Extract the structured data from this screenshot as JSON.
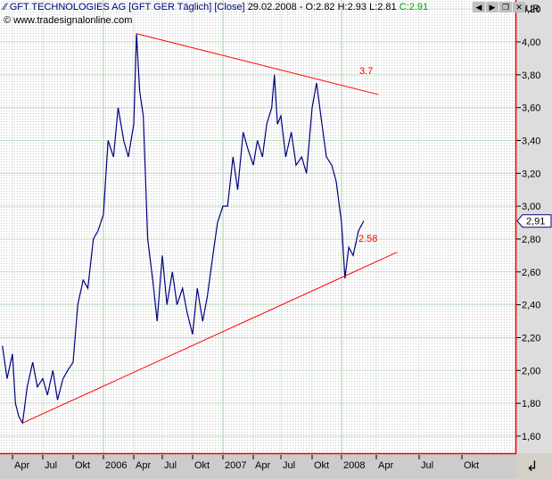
{
  "header": {
    "title": "GFT TECHNOLOGIES AG [GFT GER  Täglich] [Close]",
    "date": "29.02.2008",
    "ohlc": "- O:2.82 H:2.93 L:2.81",
    "close": "C:2.91",
    "copyright": "© www.tradesignalonline.com",
    "icons": [
      "arrow-left-icon",
      "arrow-right-icon",
      "restore-icon",
      "close-icon"
    ]
  },
  "chart_data": {
    "type": "line",
    "currency": "EUR",
    "ylim": [
      1.55,
      4.3
    ],
    "yticks": [
      "4,20",
      "4,00",
      "3,80",
      "3,60",
      "3,40",
      "3,20",
      "3,00",
      "2,80",
      "2,60",
      "2,40",
      "2,20",
      "2,00",
      "1,80",
      "1,60"
    ],
    "xticks": [
      {
        "label": "Apr",
        "date": "2005-04-01"
      },
      {
        "label": "Jul",
        "date": "2005-07-01"
      },
      {
        "label": "Okt",
        "date": "2005-10-01"
      },
      {
        "label": "2006",
        "date": "2006-01-01"
      },
      {
        "label": "Apr",
        "date": "2006-04-01"
      },
      {
        "label": "Jul",
        "date": "2006-07-01"
      },
      {
        "label": "Okt",
        "date": "2006-10-01"
      },
      {
        "label": "2007",
        "date": "2007-01-01"
      },
      {
        "label": "Apr",
        "date": "2007-04-01"
      },
      {
        "label": "Jul",
        "date": "2007-07-01"
      },
      {
        "label": "Okt",
        "date": "2007-10-01"
      },
      {
        "label": "2008",
        "date": "2008-01-01"
      },
      {
        "label": "Apr",
        "date": "2008-04-01"
      },
      {
        "label": "Jul",
        "date": "2008-07-01"
      },
      {
        "label": "Okt",
        "date": "2008-10-01"
      }
    ],
    "last_value_label": "2,91",
    "series_color": "#000080",
    "trendline_color": "#ff0000",
    "series": [
      [
        "2005-03-01",
        2.15
      ],
      [
        "2005-03-15",
        1.95
      ],
      [
        "2005-04-01",
        2.1
      ],
      [
        "2005-04-10",
        1.8
      ],
      [
        "2005-04-20",
        1.72
      ],
      [
        "2005-05-01",
        1.68
      ],
      [
        "2005-05-15",
        1.9
      ],
      [
        "2005-06-01",
        2.05
      ],
      [
        "2005-06-15",
        1.9
      ],
      [
        "2005-07-01",
        1.95
      ],
      [
        "2005-07-15",
        1.85
      ],
      [
        "2005-08-01",
        2.0
      ],
      [
        "2005-08-15",
        1.82
      ],
      [
        "2005-09-01",
        1.95
      ],
      [
        "2005-09-15",
        2.0
      ],
      [
        "2005-10-01",
        2.05
      ],
      [
        "2005-10-15",
        2.4
      ],
      [
        "2005-11-01",
        2.55
      ],
      [
        "2005-11-15",
        2.5
      ],
      [
        "2005-12-01",
        2.8
      ],
      [
        "2005-12-15",
        2.85
      ],
      [
        "2006-01-01",
        2.95
      ],
      [
        "2006-01-15",
        3.4
      ],
      [
        "2006-02-01",
        3.3
      ],
      [
        "2006-02-15",
        3.6
      ],
      [
        "2006-03-01",
        3.4
      ],
      [
        "2006-03-15",
        3.3
      ],
      [
        "2006-04-01",
        3.5
      ],
      [
        "2006-04-10",
        4.05
      ],
      [
        "2006-04-20",
        3.7
      ],
      [
        "2006-05-01",
        3.55
      ],
      [
        "2006-05-15",
        2.8
      ],
      [
        "2006-06-01",
        2.55
      ],
      [
        "2006-06-15",
        2.3
      ],
      [
        "2006-07-01",
        2.7
      ],
      [
        "2006-07-15",
        2.4
      ],
      [
        "2006-08-01",
        2.6
      ],
      [
        "2006-08-15",
        2.4
      ],
      [
        "2006-09-01",
        2.5
      ],
      [
        "2006-09-15",
        2.35
      ],
      [
        "2006-10-01",
        2.22
      ],
      [
        "2006-10-15",
        2.5
      ],
      [
        "2006-11-01",
        2.3
      ],
      [
        "2006-11-15",
        2.45
      ],
      [
        "2006-12-01",
        2.7
      ],
      [
        "2006-12-15",
        2.9
      ],
      [
        "2007-01-01",
        3.0
      ],
      [
        "2007-01-15",
        3.0
      ],
      [
        "2007-02-01",
        3.3
      ],
      [
        "2007-02-15",
        3.1
      ],
      [
        "2007-03-01",
        3.45
      ],
      [
        "2007-03-15",
        3.35
      ],
      [
        "2007-04-01",
        3.25
      ],
      [
        "2007-04-15",
        3.4
      ],
      [
        "2007-05-01",
        3.3
      ],
      [
        "2007-05-15",
        3.5
      ],
      [
        "2007-06-01",
        3.6
      ],
      [
        "2007-06-10",
        3.8
      ],
      [
        "2007-06-20",
        3.5
      ],
      [
        "2007-07-01",
        3.55
      ],
      [
        "2007-07-15",
        3.3
      ],
      [
        "2007-08-01",
        3.45
      ],
      [
        "2007-08-15",
        3.25
      ],
      [
        "2007-09-01",
        3.3
      ],
      [
        "2007-09-15",
        3.2
      ],
      [
        "2007-10-01",
        3.6
      ],
      [
        "2007-10-15",
        3.75
      ],
      [
        "2007-11-01",
        3.5
      ],
      [
        "2007-11-15",
        3.3
      ],
      [
        "2007-12-01",
        3.25
      ],
      [
        "2007-12-15",
        3.15
      ],
      [
        "2008-01-01",
        2.9
      ],
      [
        "2008-01-10",
        2.56
      ],
      [
        "2008-01-20",
        2.75
      ],
      [
        "2008-02-01",
        2.7
      ],
      [
        "2008-02-15",
        2.85
      ],
      [
        "2008-02-29",
        2.91
      ]
    ],
    "trendlines": [
      {
        "label": "3.7",
        "from": [
          "2006-04-10",
          4.05
        ],
        "to": [
          "2008-04-05",
          3.68
        ]
      },
      {
        "label": "2.58",
        "from": [
          "2005-05-01",
          1.68
        ],
        "to": [
          "2008-05-15",
          2.72
        ]
      }
    ]
  }
}
